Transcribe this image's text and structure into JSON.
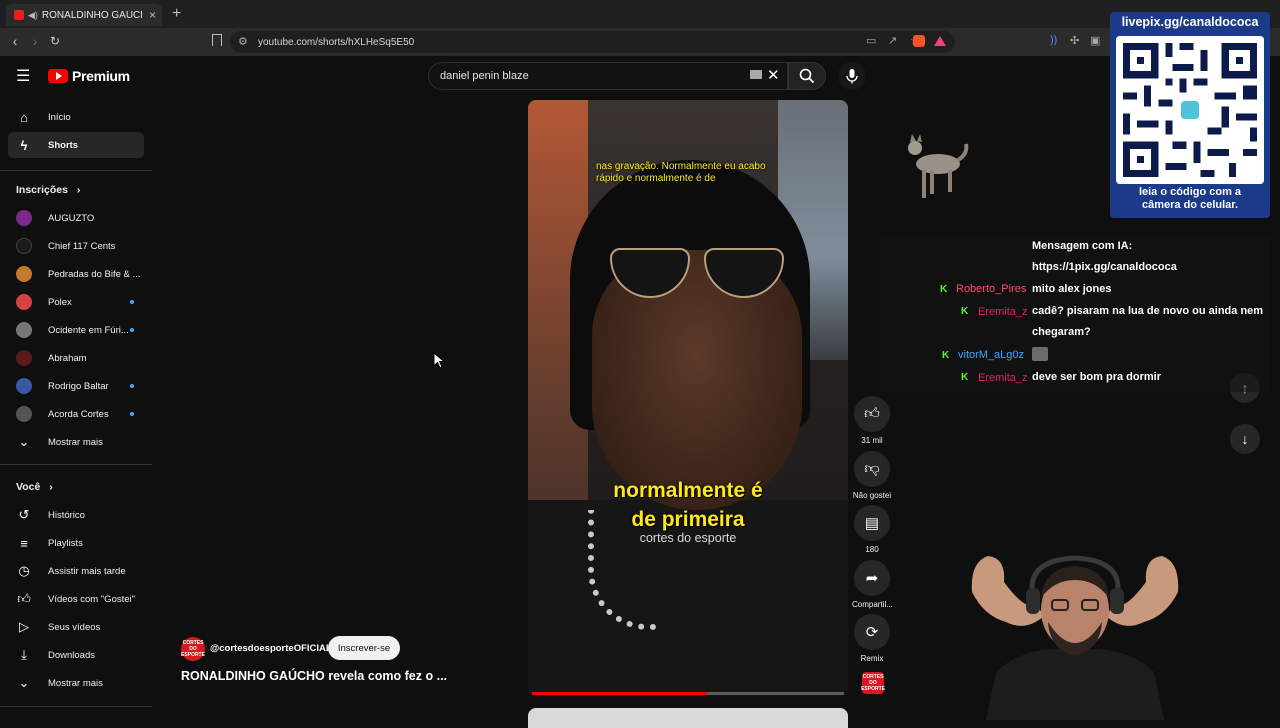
{
  "browser": {
    "tab_title": "RONALDINHO GAÚCHO reve",
    "new_tab_symbol": "+",
    "address": "youtube.com/shorts/hXLHeSq5E50"
  },
  "header": {
    "logo_text": "Premium",
    "search_query": "daniel penin blaze"
  },
  "sidebar": {
    "main": [
      {
        "label": "Início",
        "icon": "home-icon"
      },
      {
        "label": "Shorts",
        "icon": "shorts-icon",
        "active": true
      }
    ],
    "subscriptions_title": "Inscrições",
    "subscriptions": [
      {
        "label": "AUGUZTO",
        "color": "#7b2a8c",
        "dot": false
      },
      {
        "label": "Chief 117 Cents",
        "color": "#1a1a1a",
        "dot": false
      },
      {
        "label": "Pedradas do Bife & ...",
        "color": "#c47a2c",
        "dot": false
      },
      {
        "label": "Polex",
        "color": "#d94141",
        "dot": true
      },
      {
        "label": "Ocidente em Fúri...",
        "color": "#777777",
        "dot": true
      },
      {
        "label": "Abraham",
        "color": "#5a1a1a",
        "dot": false
      },
      {
        "label": "Rodrigo Baltar",
        "color": "#3a57a8",
        "dot": true
      },
      {
        "label": "Acorda Cortes",
        "color": "#555555",
        "dot": true
      }
    ],
    "subs_more": "Mostrar mais",
    "you_title": "Você",
    "you_items": [
      {
        "label": "Histórico",
        "icon": "history-icon"
      },
      {
        "label": "Playlists",
        "icon": "playlists-icon"
      },
      {
        "label": "Assistir mais tarde",
        "icon": "watch-later-icon"
      },
      {
        "label": "Vídeos com \"Gostei\"",
        "icon": "like-icon"
      },
      {
        "label": "Seus vídeos",
        "icon": "your-videos-icon"
      },
      {
        "label": "Downloads",
        "icon": "download-icon"
      }
    ],
    "you_more": "Mostrar mais"
  },
  "video": {
    "subtitle_top": "nas gravação. Normalmente eu acabo rápido e normalmente é de",
    "subtitle_big_1": "normalmente é",
    "subtitle_big_2": "de primeira",
    "subtitle_small": "cortes do esporte",
    "progress": 0.56,
    "channel": "@cortesdoesporteOFICIAL",
    "subscribe_label": "Inscrever-se",
    "title": "RONALDINHO GAÚCHO revela como fez o ...",
    "channel_badge": "CORTES DO ESPORTE"
  },
  "actions": {
    "likes": "31 mil",
    "dislike": "Não gostei",
    "comments": "180",
    "share": "Compartil...",
    "remix": "Remix"
  },
  "overlay": {
    "qr_url": "livepix.gg/canaldococa",
    "qr_note_1": "leia o código com a",
    "qr_note_2": "câmera do celular."
  },
  "chat": {
    "ai_line_1": "Mensagem com IA:",
    "ai_line_2": "https://1pix.gg/canaldococa",
    "messages": [
      {
        "user": "Roberto_Pires",
        "color": "#ff4d6a",
        "text": "mito alex jones"
      },
      {
        "user": "Eremita_z",
        "color": "#e0245e",
        "text": "cadê? pisaram na lua de novo ou ainda nem"
      },
      {
        "user": "vitorM_aLg0z",
        "color": "#3ea6ff",
        "text": ""
      },
      {
        "user": "Eremita_z",
        "color": "#e0245e",
        "text": "deve ser bom pra dormir"
      }
    ],
    "continued": "chegaram?",
    "badge": "K"
  }
}
